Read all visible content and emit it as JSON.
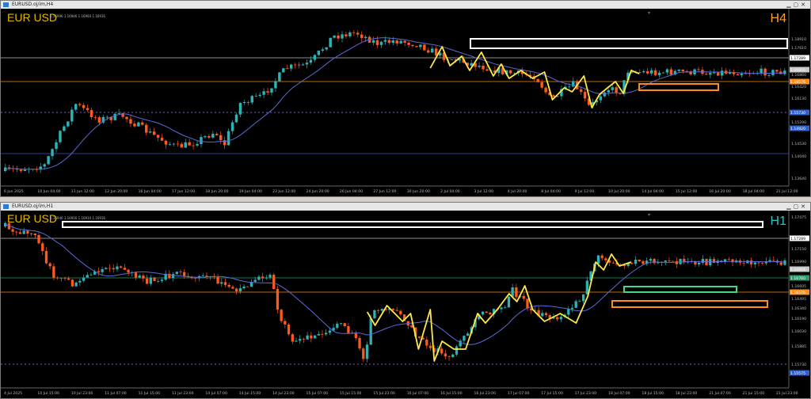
{
  "top": {
    "title": "EURUSD.oj/im,H4",
    "symbol": "EUR USD",
    "timeframe": "H4",
    "ohlc": "1.16996 1.16946 1.16993 1.16916",
    "prices": [
      "1.18910",
      "1.17610",
      "1.17289",
      "1.16916",
      "1.16860",
      "1.16576",
      "1.16420",
      "1.16130",
      "1.15730",
      "1.15290",
      "1.14920",
      "1.14530",
      "1.14040",
      "1.13640"
    ],
    "time_labels": [
      "6 Jun 2025",
      "10 Jun 04:00",
      "11 Jun 12:00",
      "12 Jun 20:00",
      "16 Jun 04:00",
      "17 Jun 12:00",
      "18 Jun 20:00",
      "19 Jun 04:00",
      "23 Jun 12:00",
      "24 Jun 20:00",
      "26 Jun 04:00",
      "27 Jun 12:00",
      "30 Jun 20:00",
      "2 Jul 04:00",
      "3 Jul 12:00",
      "4 Jul 20:00",
      "8 Jul 04:00",
      "9 Jul 12:00",
      "10 Jul 20:00",
      "14 Jul 04:00",
      "15 Jul 12:00",
      "16 Jul 20:00",
      "18 Jul 04:00",
      "21 Jul 12:00"
    ]
  },
  "bottom": {
    "title": "EURUSD.oj/im,H1",
    "symbol": "EUR USD",
    "timeframe": "H1",
    "ohlc": "1.16946 1.16916 1.16910 1.16916",
    "prices": [
      "1.17475",
      "1.17289",
      "1.17150",
      "1.16990",
      "1.16916",
      "1.16760",
      "1.16605",
      "1.16576",
      "1.16495",
      "1.16340",
      "1.16190",
      "1.16030",
      "1.15885",
      "1.15730",
      "1.15575"
    ],
    "time_labels": [
      "4 Jul 2025",
      "10 Jul 15:00",
      "10 Jul 23:00",
      "11 Jul 07:00",
      "11 Jul 15:00",
      "11 Jul 23:00",
      "14 Jul 07:00",
      "14 Jul 15:00",
      "14 Jul 23:00",
      "15 Jul 07:00",
      "15 Jul 15:00",
      "15 Jul 23:00",
      "16 Jul 07:00",
      "16 Jul 15:00",
      "16 Jul 23:00",
      "17 Jul 07:00",
      "17 Jul 15:00",
      "17 Jul 23:00",
      "18 Jul 07:00",
      "18 Jul 15:00",
      "18 Jul 23:00",
      "21 Jul 07:00",
      "21 Jul 15:00",
      "21 Jul 23:00"
    ]
  },
  "colors": {
    "bull": "#2db3b3",
    "bear": "#ff5a1e",
    "ma": "#5a6ad8",
    "zigzag": "#ffe845",
    "box_white": "#ffffff",
    "box_orange": "#ff8c1a",
    "box_green": "#40d890",
    "h4_label": "#ff9d2a",
    "h1_label": "#2ec4c4"
  }
}
